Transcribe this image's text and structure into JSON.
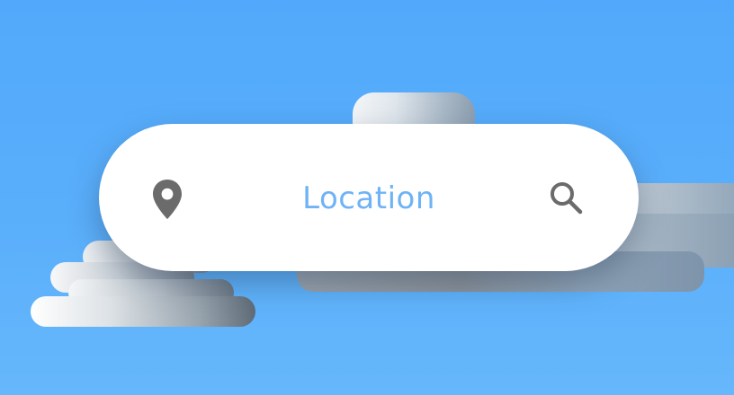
{
  "search_bar": {
    "label": "Location",
    "label_color": "#6fb3f4",
    "background": "#ffffff",
    "leading_icon": "location-pin-icon",
    "trailing_icon": "search-icon",
    "icon_color": "#6b6b6b"
  },
  "scene": {
    "background": "#55abfb",
    "decoration": "clouds"
  }
}
